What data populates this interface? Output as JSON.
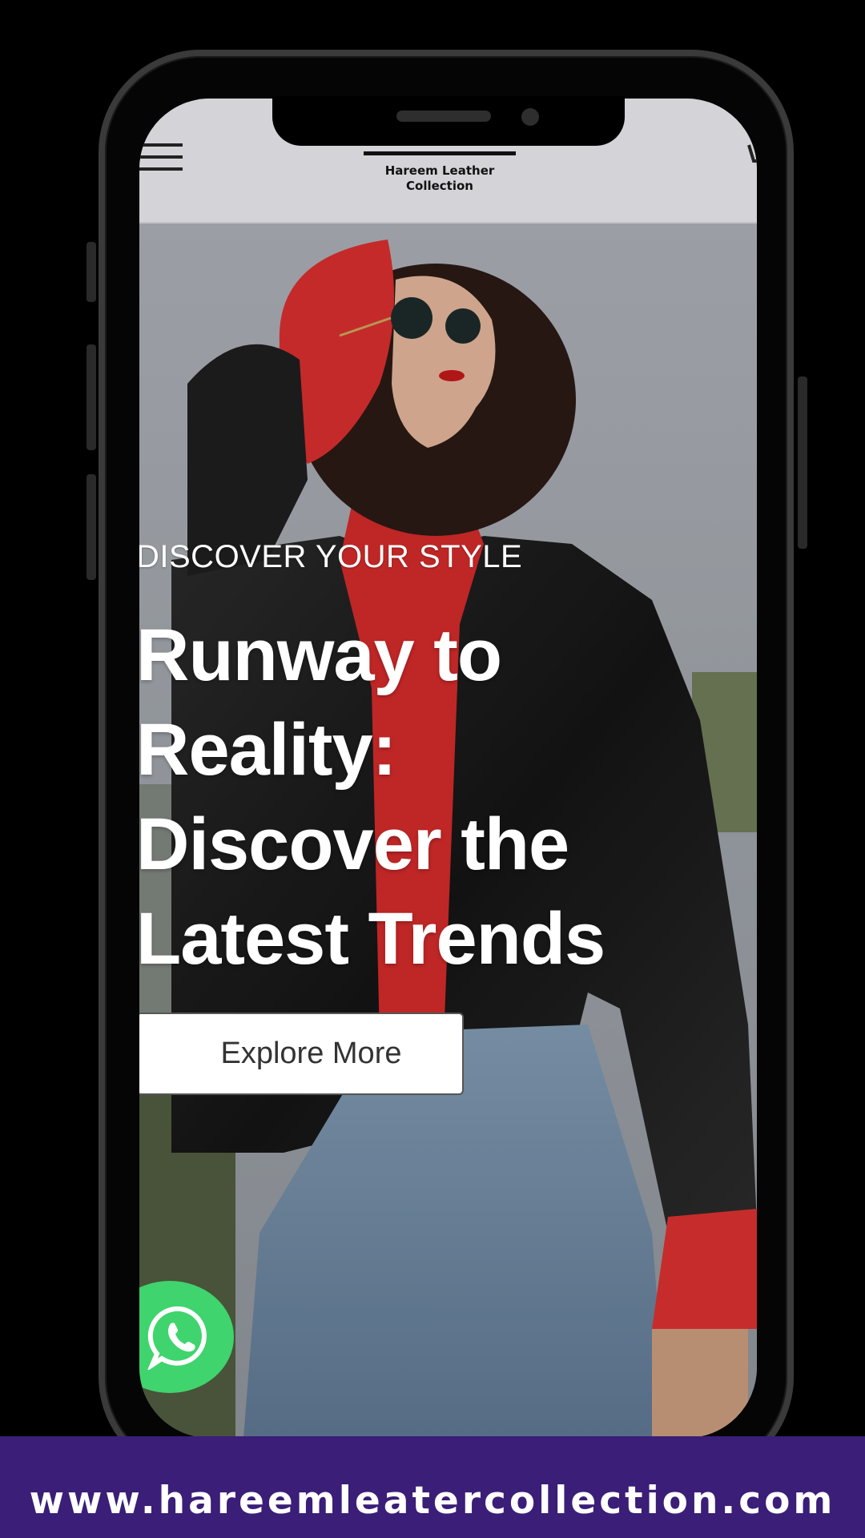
{
  "header": {
    "menu_icon": "hamburger-menu-icon",
    "logo_line1": "Hareem Leather",
    "logo_line2": "Collection"
  },
  "hero": {
    "eyebrow": "DISCOVER YOUR STYLE",
    "title_line1": "Runway to",
    "title_line2": "Reality:",
    "title_line3": "Discover the",
    "title_line4": "Latest Trends",
    "cta_label": "Explore More"
  },
  "floating": {
    "whatsapp_icon": "whatsapp-icon"
  },
  "footer": {
    "url": "www.hareemleatercollection.com"
  },
  "colors": {
    "footer_bg": "#3a1e77",
    "whatsapp_green": "#3fd46d",
    "header_bg": "#d4d4d8"
  }
}
